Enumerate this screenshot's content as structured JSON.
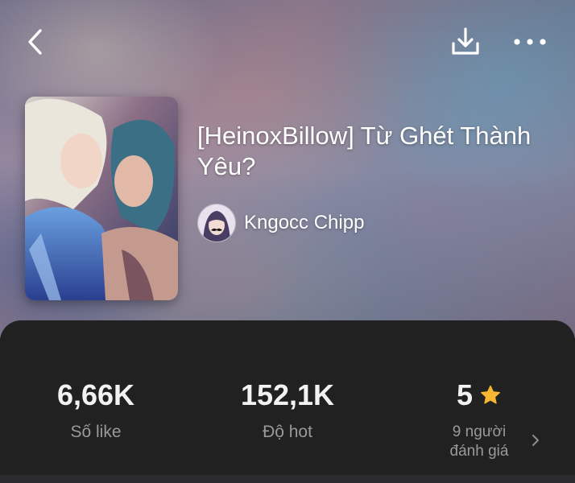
{
  "header": {
    "back_icon": "chevron-left-icon",
    "download_icon": "download-icon",
    "more_icon": "more-horizontal-icon"
  },
  "story": {
    "title": "[HeinoxBillow] Từ Ghét Thành Yêu?",
    "author": "Kngocc Chipp"
  },
  "stats": {
    "likes": {
      "value": "6,66K",
      "label": "Số like"
    },
    "hot": {
      "value": "152,1K",
      "label": "Độ hot"
    },
    "rating": {
      "value": "5",
      "count_line1": "9 người",
      "count_line2": "đánh giá",
      "star_color": "#f5b731"
    }
  },
  "colors": {
    "panel_bg": "#212122",
    "stat_value": "#f2f2f2",
    "stat_label": "#9a9a9a"
  }
}
